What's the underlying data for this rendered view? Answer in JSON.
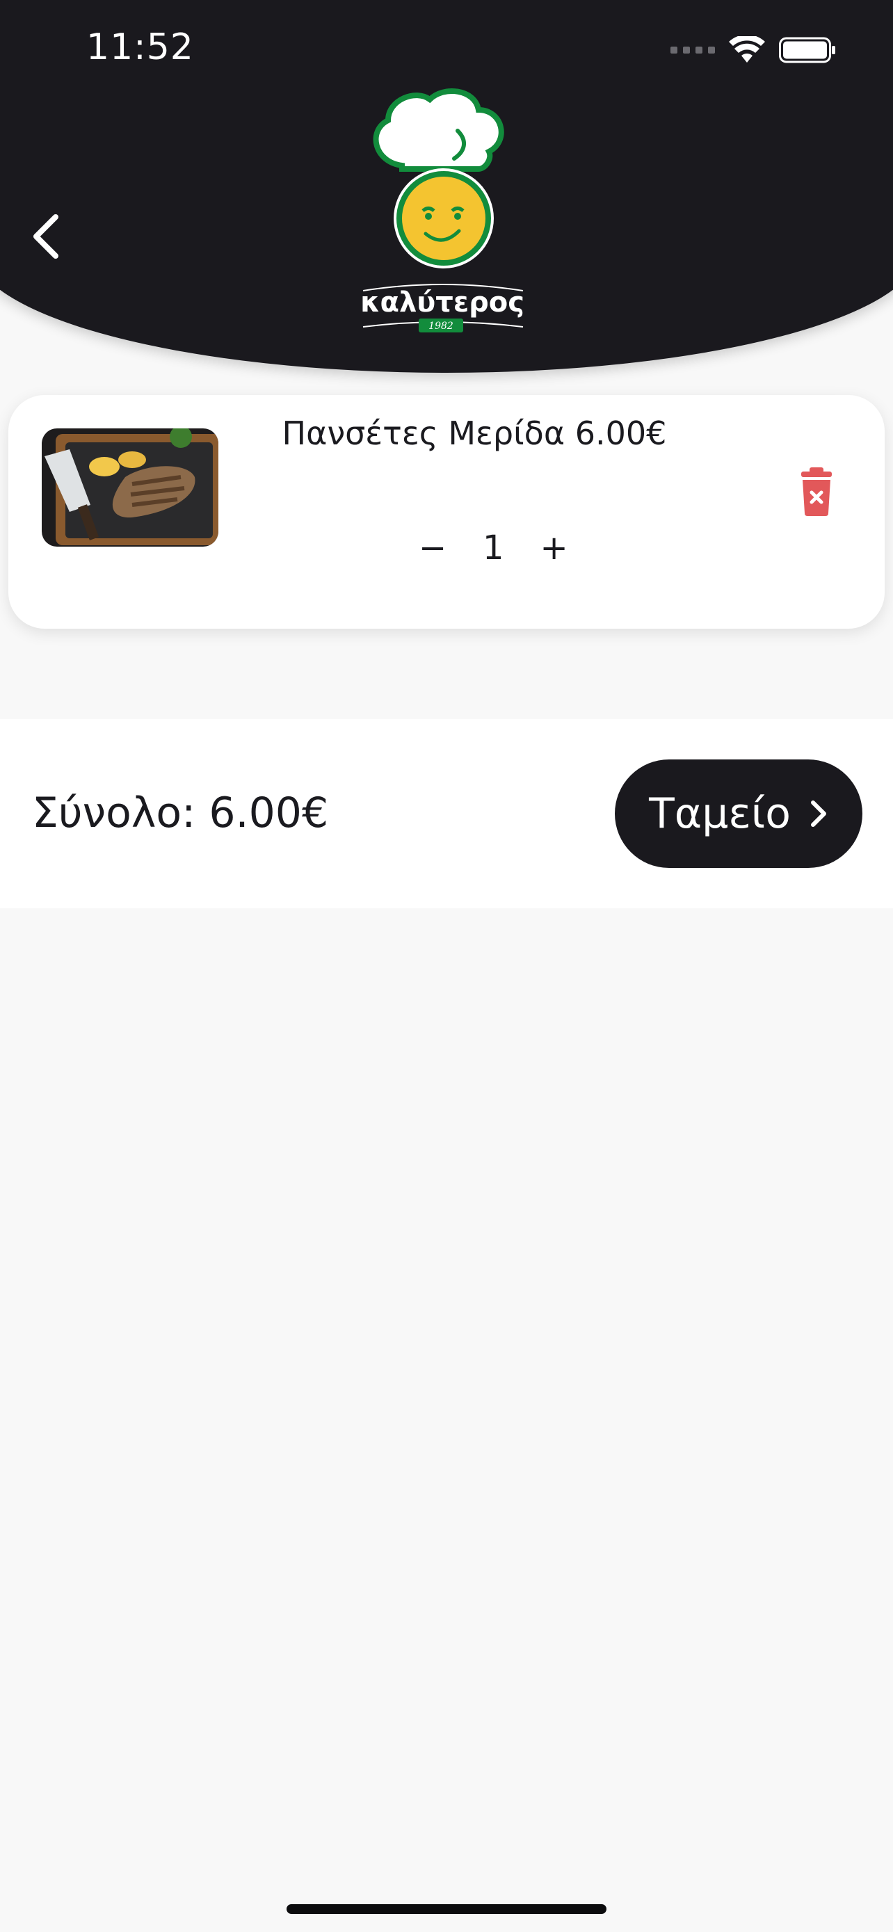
{
  "status_bar": {
    "time": "11:52",
    "icons": [
      "signal-icon",
      "wifi-icon",
      "battery-icon"
    ]
  },
  "header": {
    "back_icon": "chevron-left-icon",
    "logo": {
      "name": "καλύτερος",
      "year": "1982"
    },
    "background": "#1a191e"
  },
  "cart": {
    "items": [
      {
        "title": "Πανσέτες Μερίδα 6.00€",
        "quantity": "1",
        "minus": "−",
        "plus": "+",
        "image": "grilled-meat-photo",
        "delete_icon": "trash-icon"
      }
    ]
  },
  "footer": {
    "total_label": "Σύνολο: 6.00€",
    "checkout_label": "Ταμείο",
    "checkout_icon": "chevron-right-icon"
  },
  "colors": {
    "dark": "#1a191e",
    "trash": "#e2585a",
    "logo_green": "#128c3c",
    "logo_yellow": "#f4c430"
  }
}
